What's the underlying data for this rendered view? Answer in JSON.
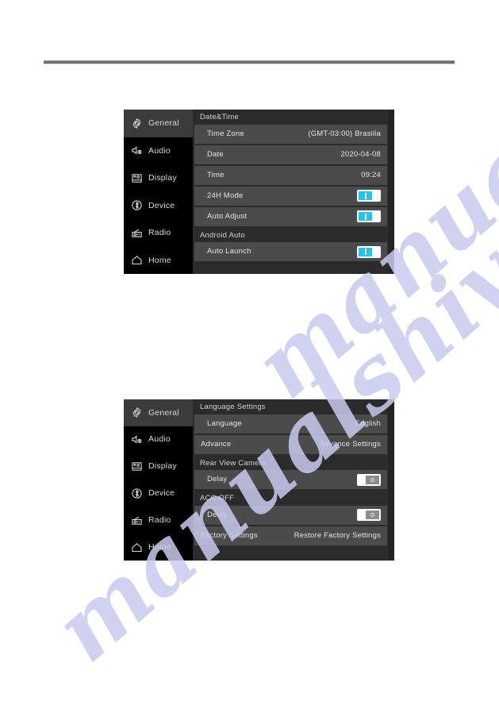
{
  "watermark": {
    "text_top": "manualshive.com",
    "text_bottom": "manualshive.com",
    "color": "#c9c9ee"
  },
  "theme": {
    "accent_on": "#29c2e8",
    "panel_bg": "#2b2b2b",
    "row_bg": "#4b4b4b",
    "sidebar_bg": "#000000",
    "sidebar_selected_bg": "#3b3b3b"
  },
  "sidebar": {
    "items": [
      {
        "label": "General",
        "icon": "gear-icon",
        "selected": true
      },
      {
        "label": "Audio",
        "icon": "speaker-gear-icon",
        "selected": false
      },
      {
        "label": "Display",
        "icon": "monitor-icon",
        "selected": false
      },
      {
        "label": "Device",
        "icon": "bluetooth-icon",
        "selected": false
      },
      {
        "label": "Radio",
        "icon": "radio-icon",
        "selected": false
      },
      {
        "label": "Home",
        "icon": "home-icon",
        "selected": false
      }
    ]
  },
  "screens": [
    {
      "id": "datetime",
      "sections": [
        {
          "title": "Date&Time",
          "rows": [
            {
              "label": "Time Zone",
              "value": "(GMT-03:00) Brasilia",
              "type": "value",
              "indent": true
            },
            {
              "label": "Date",
              "value": "2020-04-08",
              "type": "value",
              "indent": true
            },
            {
              "label": "Time",
              "value": "09:24",
              "type": "value",
              "indent": true
            },
            {
              "label": "24H Mode",
              "type": "toggle",
              "state": "on",
              "indent": true
            },
            {
              "label": "Auto Adjust",
              "type": "toggle",
              "state": "on",
              "indent": true
            }
          ]
        },
        {
          "title": "Android Auto",
          "rows": [
            {
              "label": "Auto Launch",
              "type": "toggle",
              "state": "on",
              "indent": true
            }
          ]
        }
      ]
    },
    {
      "id": "language",
      "sections": [
        {
          "title": "Language Settings",
          "rows": [
            {
              "label": "Language",
              "value": "English",
              "type": "value",
              "indent": true
            },
            {
              "label": "Advance",
              "value": "Advance Settings",
              "type": "value",
              "indent": false
            }
          ]
        },
        {
          "title": "Rear View Camera",
          "rows": [
            {
              "label": "Delay",
              "type": "toggle",
              "state": "off",
              "indent": true
            }
          ]
        },
        {
          "title": "ACC OFF",
          "rows": [
            {
              "label": "Delay",
              "type": "toggle",
              "state": "off",
              "indent": true
            },
            {
              "label": "Factory Settings",
              "value": "Restore Factory Settings",
              "type": "value",
              "indent": false
            }
          ]
        }
      ]
    }
  ]
}
